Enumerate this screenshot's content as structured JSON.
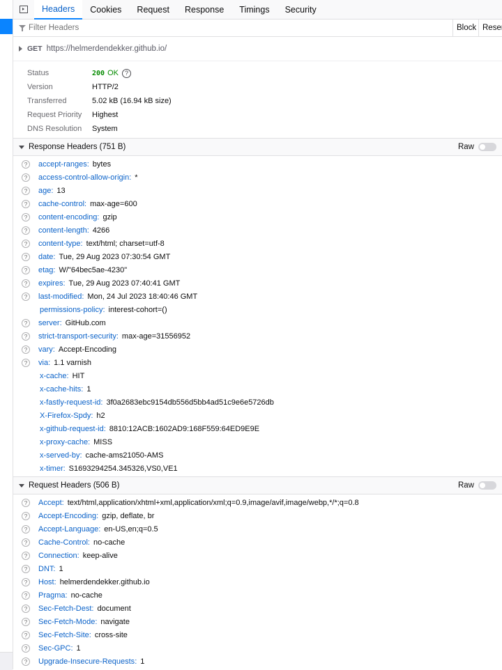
{
  "tabs": [
    {
      "label": "Headers",
      "active": true
    },
    {
      "label": "Cookies",
      "active": false
    },
    {
      "label": "Request",
      "active": false
    },
    {
      "label": "Response",
      "active": false
    },
    {
      "label": "Timings",
      "active": false
    },
    {
      "label": "Security",
      "active": false
    }
  ],
  "filter": {
    "placeholder": "Filter Headers",
    "block_label": "Block",
    "resend_label": "Reser"
  },
  "request_line": {
    "method": "GET",
    "url": "https://helmerdendekker.github.io/"
  },
  "summary": {
    "status": {
      "label": "Status",
      "code": "200",
      "text": "OK"
    },
    "version": {
      "label": "Version",
      "value": "HTTP/2"
    },
    "transferred": {
      "label": "Transferred",
      "value": "5.02 kB (16.94 kB size)"
    },
    "priority": {
      "label": "Request Priority",
      "value": "Highest"
    },
    "dns": {
      "label": "DNS Resolution",
      "value": "System"
    }
  },
  "response_headers": {
    "title": "Response Headers (751 B)",
    "raw_label": "Raw",
    "items": [
      {
        "name": "accept-ranges",
        "value": "bytes",
        "help": true
      },
      {
        "name": "access-control-allow-origin",
        "value": "*",
        "help": true
      },
      {
        "name": "age",
        "value": "13",
        "help": true
      },
      {
        "name": "cache-control",
        "value": "max-age=600",
        "help": true
      },
      {
        "name": "content-encoding",
        "value": "gzip",
        "help": true
      },
      {
        "name": "content-length",
        "value": "4266",
        "help": true
      },
      {
        "name": "content-type",
        "value": "text/html; charset=utf-8",
        "help": true
      },
      {
        "name": "date",
        "value": "Tue, 29 Aug 2023 07:30:54 GMT",
        "help": true
      },
      {
        "name": "etag",
        "value": "W/\"64bec5ae-4230\"",
        "help": true
      },
      {
        "name": "expires",
        "value": "Tue, 29 Aug 2023 07:40:41 GMT",
        "help": true
      },
      {
        "name": "last-modified",
        "value": "Mon, 24 Jul 2023 18:40:46 GMT",
        "help": true
      },
      {
        "name": "permissions-policy",
        "value": "interest-cohort=()",
        "help": false
      },
      {
        "name": "server",
        "value": "GitHub.com",
        "help": true
      },
      {
        "name": "strict-transport-security",
        "value": "max-age=31556952",
        "help": true
      },
      {
        "name": "vary",
        "value": "Accept-Encoding",
        "help": true
      },
      {
        "name": "via",
        "value": "1.1 varnish",
        "help": true
      },
      {
        "name": "x-cache",
        "value": "HIT",
        "help": false
      },
      {
        "name": "x-cache-hits",
        "value": "1",
        "help": false
      },
      {
        "name": "x-fastly-request-id",
        "value": "3f0a2683ebc9154db556d5bb4ad51c9e6e5726db",
        "help": false
      },
      {
        "name": "X-Firefox-Spdy",
        "value": "h2",
        "help": false
      },
      {
        "name": "x-github-request-id",
        "value": "8810:12ACB:1602AD9:168F559:64ED9E9E",
        "help": false
      },
      {
        "name": "x-proxy-cache",
        "value": "MISS",
        "help": false
      },
      {
        "name": "x-served-by",
        "value": "cache-ams21050-AMS",
        "help": false
      },
      {
        "name": "x-timer",
        "value": "S1693294254.345326,VS0,VE1",
        "help": false
      }
    ]
  },
  "request_headers": {
    "title": "Request Headers (506 B)",
    "raw_label": "Raw",
    "items": [
      {
        "name": "Accept",
        "value": "text/html,application/xhtml+xml,application/xml;q=0.9,image/avif,image/webp,*/*;q=0.8",
        "help": true
      },
      {
        "name": "Accept-Encoding",
        "value": "gzip, deflate, br",
        "help": true
      },
      {
        "name": "Accept-Language",
        "value": "en-US,en;q=0.5",
        "help": true
      },
      {
        "name": "Cache-Control",
        "value": "no-cache",
        "help": true
      },
      {
        "name": "Connection",
        "value": "keep-alive",
        "help": true
      },
      {
        "name": "DNT",
        "value": "1",
        "help": true
      },
      {
        "name": "Host",
        "value": "helmerdendekker.github.io",
        "help": true
      },
      {
        "name": "Pragma",
        "value": "no-cache",
        "help": true
      },
      {
        "name": "Sec-Fetch-Dest",
        "value": "document",
        "help": true
      },
      {
        "name": "Sec-Fetch-Mode",
        "value": "navigate",
        "help": true
      },
      {
        "name": "Sec-Fetch-Site",
        "value": "cross-site",
        "help": true
      },
      {
        "name": "Sec-GPC",
        "value": "1",
        "help": true
      },
      {
        "name": "Upgrade-Insecure-Requests",
        "value": "1",
        "help": true
      }
    ]
  }
}
